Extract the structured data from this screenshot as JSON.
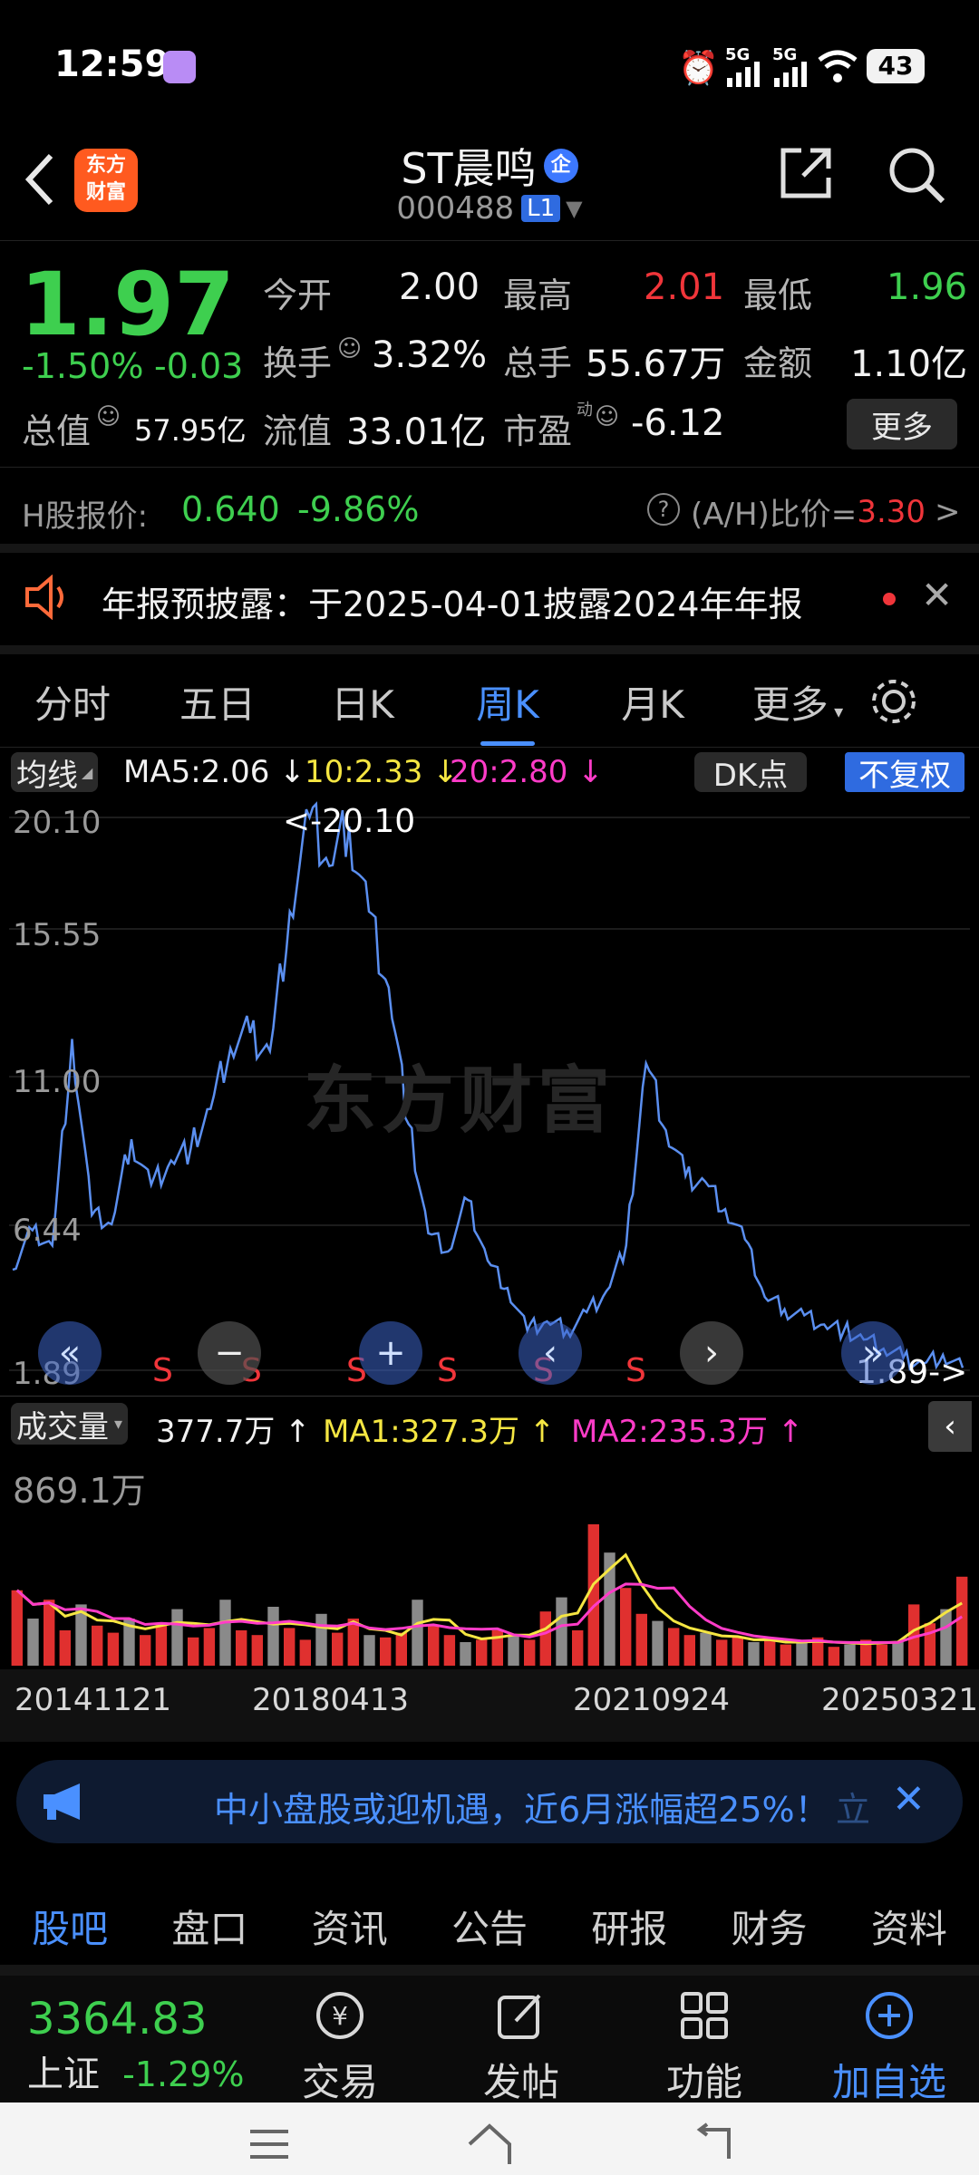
{
  "status_bar": {
    "time": "12:59",
    "signal1": "5G",
    "signal2": "5G",
    "battery": "43"
  },
  "header": {
    "logo_text": "东方\n财富",
    "stock_name": "ST晨鸣",
    "badge": "企",
    "code": "000488",
    "level": "L1"
  },
  "quote": {
    "price": "1.97",
    "change_pct": "-1.50%",
    "change": "-0.03",
    "open_label": "今开",
    "open": "2.00",
    "high_label": "最高",
    "high": "2.01",
    "low_label": "最低",
    "low": "1.96",
    "turnover_label": "换手",
    "turnover": "3.32%",
    "volume_label": "总手",
    "volume": "55.67万",
    "amount_label": "金额",
    "amount": "1.10亿",
    "mktcap_label": "总值",
    "mktcap": "57.95亿",
    "float_label": "流值",
    "float": "33.01亿",
    "pe_label": "市盈",
    "pe_sup": "动",
    "pe": "-6.12",
    "more_btn": "更多",
    "h_label": "H股报价:",
    "h_price": "0.640",
    "h_pct": "-9.86%",
    "ah_label": "(A/H)比价=",
    "ah_value": "3.30"
  },
  "notice": {
    "text": "年报预披露：于2025-04-01披露2024年年报"
  },
  "tabs": [
    "分时",
    "五日",
    "日K",
    "周K",
    "月K",
    "更多"
  ],
  "chart_toolbar": {
    "ma_btn": "均线",
    "ma5": "MA5:2.06",
    "ma10": "10:2.33",
    "ma20": "20:2.80",
    "dk_btn": "DK点",
    "fq_btn": "不复权"
  },
  "price_axis": [
    "20.10",
    "15.55",
    "11.00",
    "6.44",
    "1.89"
  ],
  "price_max_label": "<-20.10",
  "price_min_label": "1.89->",
  "watermark": "东方财富",
  "s_marks": [
    "S",
    "S",
    "S",
    "S",
    "S",
    "S"
  ],
  "volume_toolbar": {
    "btn": "成交量",
    "vol": "377.7万",
    "ma1": "MA1:327.3万",
    "ma2": "MA2:235.3万"
  },
  "volume_axis_max": "869.1万",
  "date_axis": [
    "20141121",
    "20180413",
    "20210924",
    "20250321"
  ],
  "banner": {
    "text": "中小盘股或迎机遇，近6月涨幅超25%！",
    "tail": "立"
  },
  "bottom_tabs": [
    "股吧",
    "盘口",
    "资讯",
    "公告",
    "研报",
    "财务",
    "资料"
  ],
  "dock": {
    "index_value": "3364.83",
    "index_name": "上证",
    "index_pct": "-1.29%",
    "trade": "交易",
    "post": "发帖",
    "func": "功能",
    "add": "加自选"
  },
  "colors": {
    "up": "#f0353a",
    "down": "#3ecf4f",
    "accent": "#4a90ff",
    "line": "#5b8ff0",
    "ma1": "#f5e642",
    "ma2": "#ff3cc8"
  },
  "chart_data": {
    "type": "line",
    "price_series": [
      5.2,
      6.5,
      6.0,
      12.8,
      7.0,
      6.7,
      9.5,
      8.0,
      8.8,
      9.2,
      10.5,
      12.5,
      13.0,
      12.4,
      17.0,
      20.1,
      18.5,
      19.8,
      17.0,
      14.5,
      10.0,
      6.4,
      5.8,
      7.5,
      5.5,
      4.6,
      3.2,
      3.5,
      3.2,
      3.8,
      4.5,
      6.0,
      12.0,
      9.8,
      8.3,
      8.1,
      7.2,
      6.2,
      4.3,
      3.9,
      3.7,
      3.4,
      3.2,
      2.9,
      2.6,
      2.3,
      2.1,
      2.4,
      1.97
    ],
    "ylim": [
      1.89,
      20.1
    ],
    "volume_series": [
      3.2,
      2.0,
      2.8,
      1.5,
      2.6,
      1.7,
      1.4,
      2.0,
      1.3,
      1.8,
      2.4,
      1.2,
      1.6,
      2.8,
      1.5,
      1.3,
      2.5,
      1.6,
      1.1,
      2.2,
      1.4,
      2.0,
      1.3,
      1.2,
      1.4,
      2.8,
      1.7,
      1.3,
      1.0,
      1.1,
      1.5,
      1.3,
      1.1,
      2.3,
      2.9,
      1.5,
      6.0,
      4.8,
      3.3,
      2.2,
      1.9,
      1.6,
      1.3,
      1.4,
      1.1,
      1.2,
      1.0,
      1.1,
      0.9,
      1.0,
      1.2,
      0.8,
      0.9,
      1.1,
      0.9,
      1.0,
      2.6,
      1.8,
      2.4,
      3.777
    ],
    "volume_max": 8.691,
    "x_labels": [
      "20141121",
      "20180413",
      "20210924",
      "20250321"
    ]
  }
}
